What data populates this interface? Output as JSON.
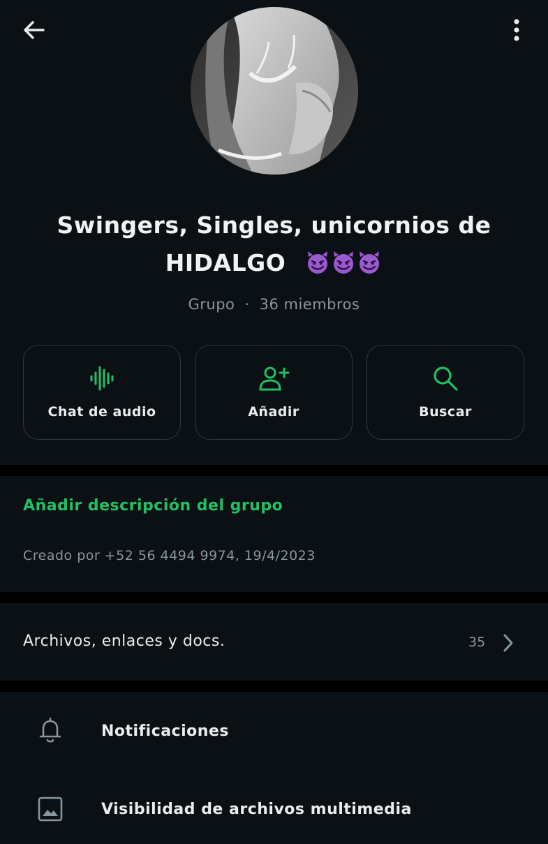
{
  "group": {
    "title_line1": "Swingers, Singles, unicornios de",
    "title_line2": "HIDALGO",
    "title_emoji": "smiling-devil-emoji x3",
    "type_label": "Grupo",
    "separator": "·",
    "members": "36 miembros"
  },
  "actions": [
    {
      "label": "Chat de audio",
      "icon": "audio-waveform-icon"
    },
    {
      "label": "Añadir",
      "icon": "add-person-icon"
    },
    {
      "label": "Buscar",
      "icon": "search-icon"
    }
  ],
  "description": {
    "add_label": "Añadir descripción del grupo",
    "created": "Creado por +52 56 4494 9974, 19/4/2023"
  },
  "media": {
    "label": "Archivos, enlaces y docs.",
    "count": "35"
  },
  "settings": [
    {
      "label": "Notificaciones",
      "icon": "bell-icon"
    },
    {
      "label": "Visibilidad de archivos multimedia",
      "icon": "image-icon"
    }
  ],
  "colors": {
    "background": "#0b1014",
    "accent": "#21c063",
    "text_primary": "#e9edef",
    "text_secondary": "#8696a0",
    "border": "#30383d",
    "emoji": "#9b59d0"
  }
}
